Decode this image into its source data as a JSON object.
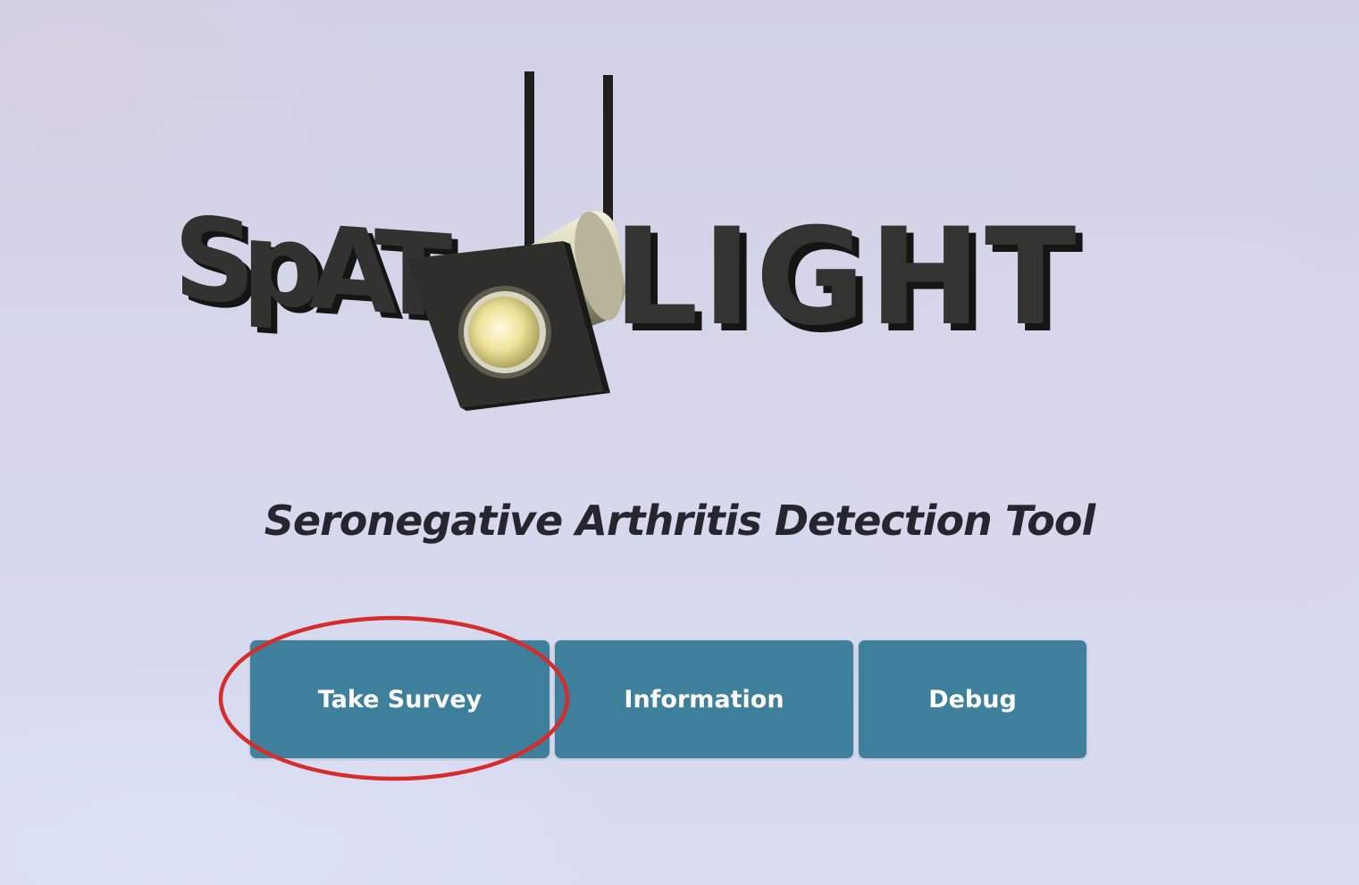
{
  "logo": {
    "left_text": "SpAT",
    "right_text": "LIGHT",
    "letter_color": "#2f2f2d",
    "lamp_body_color": "#c9c6a8",
    "lamp_lens_color": "#f4ecb0"
  },
  "subtitle": "Seronegative Arthritis Detection Tool",
  "buttons": {
    "take_survey": "Take Survey",
    "information": "Information",
    "debug": "Debug",
    "color": "#3e7f9c"
  },
  "annotation": {
    "shape": "ellipse",
    "color": "#d62c2c",
    "target": "take_survey"
  }
}
